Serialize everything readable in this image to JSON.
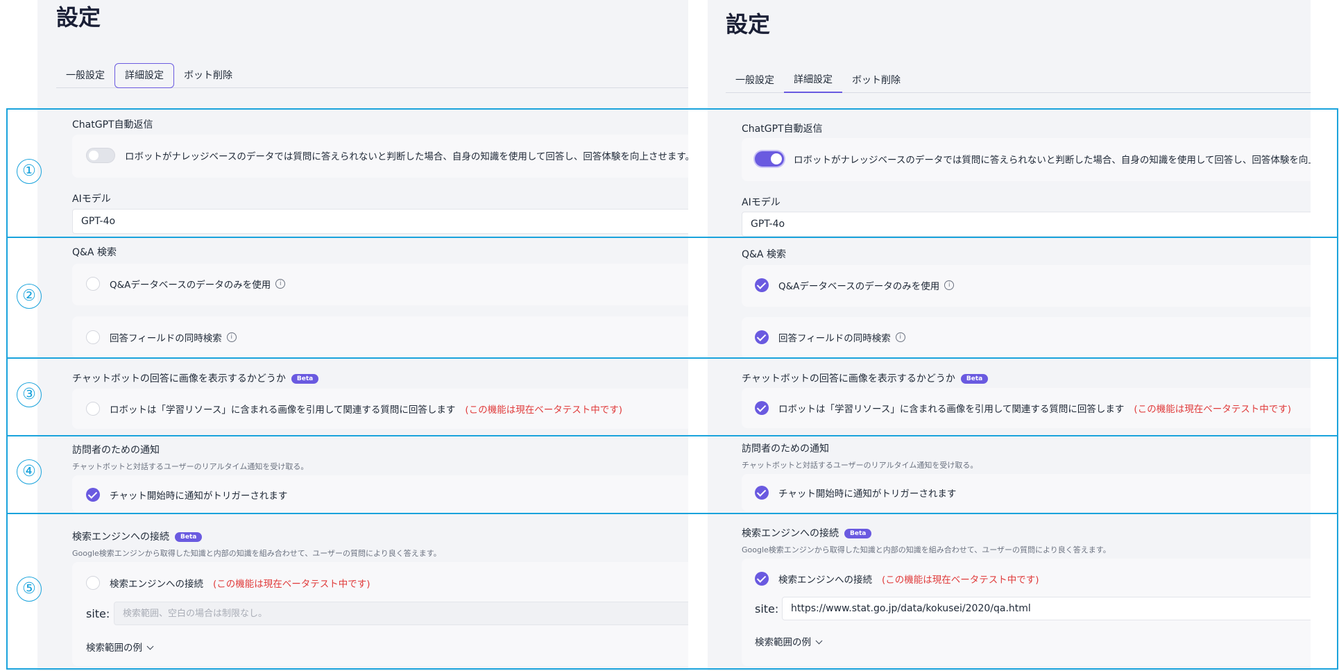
{
  "page_title": "設定",
  "tabs": [
    "一般設定",
    "詳細設定",
    "ボット削除"
  ],
  "chatgpt": {
    "label": "ChatGPT自動返信",
    "toggle_text": "ロボットがナレッジベースのデータでは質問に答えられないと判断した場合、自身の知識を使用して回答し、回答体験を向上させます。"
  },
  "ai_model": {
    "label": "AIモデル",
    "value": "GPT-4o"
  },
  "qa_search": {
    "label": "Q&A 検索",
    "option_1": "Q&Aデータベースのデータのみを使用",
    "option_2": "回答フィールドの同時検索"
  },
  "image_display": {
    "label": "チャットボットの回答に画像を表示するかどうか",
    "badge": "Beta",
    "option": "ロボットは「学習リソース」に含まれる画像を引用して関連する質問に回答します",
    "note": "(この機能は現在ベータテスト中です)"
  },
  "visitor_notify": {
    "label": "訪問者のための通知",
    "description": "チャットボットと対話するユーザーのリアルタイム通知を受け取る。",
    "option": "チャット開始時に通知がトリガーされます"
  },
  "search_engine": {
    "label": "検索エンジンへの接続",
    "badge": "Beta",
    "description": "Google検索エンジンから取得した知識と内部の知識を組み合わせて、ユーザーの質問により良く答えます。",
    "option": "検索エンジンへの接続",
    "note": "(この機能は現在ベータテスト中です)",
    "site_label": "site:",
    "site_placeholder": "検索範囲、空白の場合は制限なし。",
    "site_value_right": "https://www.stat.go.jp/data/kokusei/2020/qa.html",
    "examples_label": "検索範囲の例"
  },
  "annotations": [
    "①",
    "②",
    "③",
    "④",
    "⑤"
  ],
  "colors": {
    "accent": "#6a5ae0",
    "outline": "#1aa3dc",
    "warning": "#e03b3b"
  }
}
